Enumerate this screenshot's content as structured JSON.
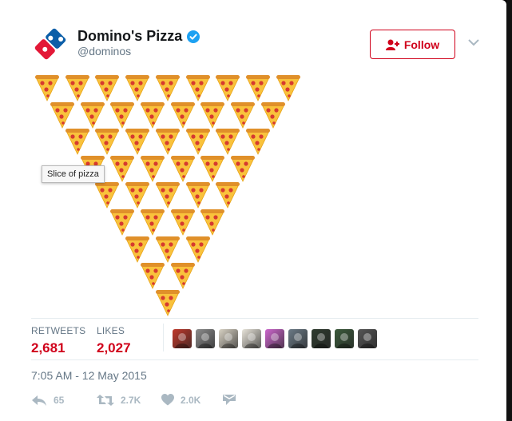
{
  "account": {
    "display_name": "Domino's Pizza",
    "handle": "@dominos"
  },
  "follow_label": "Follow",
  "tooltip": "Slice of pizza",
  "pizza_rows": [
    9,
    8,
    7,
    6,
    5,
    4,
    3,
    2,
    1
  ],
  "stats": {
    "retweets_label": "RETWEETS",
    "retweets": "2,681",
    "likes_label": "LIKES",
    "likes": "2,027"
  },
  "avatars": [
    {
      "name": "avatar-1",
      "color": "#c0392b"
    },
    {
      "name": "avatar-2",
      "color": "#8c8c8c"
    },
    {
      "name": "avatar-3",
      "color": "#d8d2c4"
    },
    {
      "name": "avatar-4",
      "color": "#e8e4da"
    },
    {
      "name": "avatar-5",
      "color": "#cc66cc"
    },
    {
      "name": "avatar-6",
      "color": "#6b7a86"
    },
    {
      "name": "avatar-7",
      "color": "#2f3b2f"
    },
    {
      "name": "avatar-8",
      "color": "#3c5a3c"
    },
    {
      "name": "avatar-9",
      "color": "#555555"
    }
  ],
  "timestamp": "7:05 AM - 12 May 2015",
  "actions": {
    "reply_count": "65",
    "retweet_count": "2.7K",
    "like_count": "2.0K"
  },
  "colors": {
    "brand_red": "#d0021b",
    "dominos_blue": "#0b5ea8",
    "dominos_red": "#e31837",
    "verified_blue": "#1da1f2"
  }
}
